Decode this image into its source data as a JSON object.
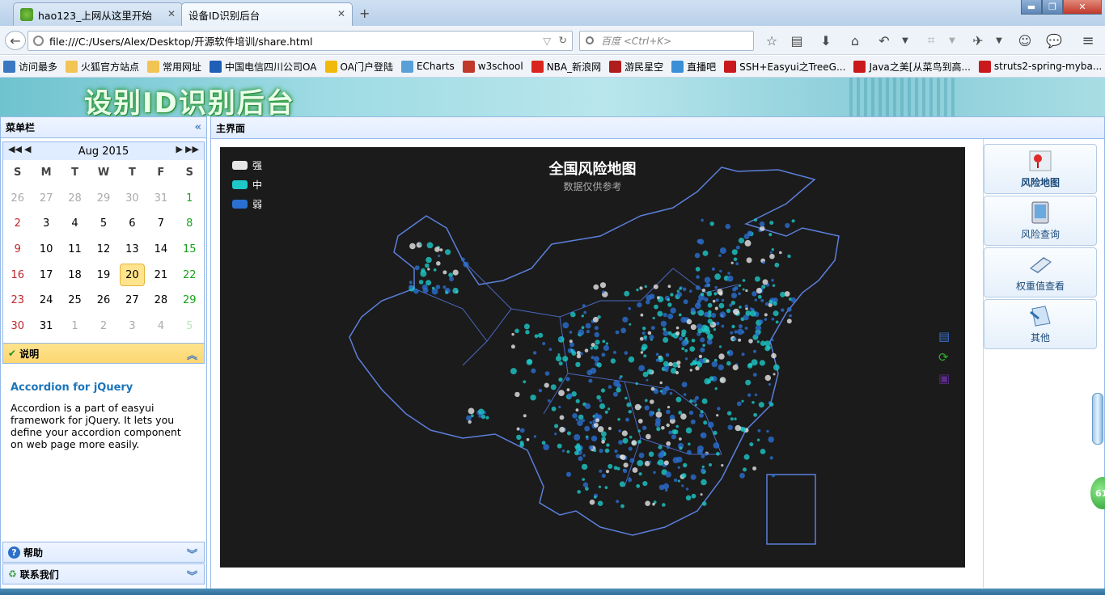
{
  "browser": {
    "tabs": [
      {
        "title": "hao123_上网从这里开始",
        "active": false
      },
      {
        "title": "设备ID识别后台",
        "active": true
      }
    ],
    "url": "file:///C:/Users/Alex/Desktop/开源软件培训/share.html",
    "search_placeholder": "百度 <Ctrl+K>",
    "bookmarks": [
      {
        "label": "访问最多",
        "icon": "gear-bookmark-icon",
        "color": "#3b78c2"
      },
      {
        "label": "火狐官方站点",
        "icon": "folder-icon",
        "color": "#f1c453"
      },
      {
        "label": "常用网址",
        "icon": "folder-icon",
        "color": "#f1c453"
      },
      {
        "label": "中国电信四川公司OA",
        "icon": "telecom-icon",
        "color": "#1f5fb6"
      },
      {
        "label": "OA门户登陆",
        "icon": "star-icon",
        "color": "#f0b90b"
      },
      {
        "label": "ECharts",
        "icon": "echarts-icon",
        "color": "#5aa0d8"
      },
      {
        "label": "w3school",
        "icon": "w3school-icon",
        "color": "#c0392b"
      },
      {
        "label": "NBA_新浪网",
        "icon": "sina-icon",
        "color": "#d9251d"
      },
      {
        "label": "游民星空",
        "icon": "gamersky-icon",
        "color": "#b01d1d"
      },
      {
        "label": "直播吧",
        "icon": "zhibo8-icon",
        "color": "#3b8fd6"
      },
      {
        "label": "SSH+Easyui之TreeG...",
        "icon": "csdn-icon",
        "color": "#c9191d"
      },
      {
        "label": "Java之美[从菜鸟到高...",
        "icon": "csdn-icon",
        "color": "#c9191d"
      },
      {
        "label": "struts2-spring-myba...",
        "icon": "csdn-icon",
        "color": "#c9191d"
      }
    ]
  },
  "banner": {
    "title": "设别ID识别后台"
  },
  "west": {
    "title": "菜单栏",
    "calendar": {
      "month_label": "Aug 2015",
      "weekdays": [
        "S",
        "M",
        "T",
        "W",
        "T",
        "F",
        "S"
      ],
      "weeks": [
        [
          "26",
          "27",
          "28",
          "29",
          "30",
          "31",
          "1"
        ],
        [
          "2",
          "3",
          "4",
          "5",
          "6",
          "7",
          "8"
        ],
        [
          "9",
          "10",
          "11",
          "12",
          "13",
          "14",
          "15"
        ],
        [
          "16",
          "17",
          "18",
          "19",
          "20",
          "21",
          "22"
        ],
        [
          "23",
          "24",
          "25",
          "26",
          "27",
          "28",
          "29"
        ],
        [
          "30",
          "31",
          "1",
          "2",
          "3",
          "4",
          "5"
        ]
      ],
      "today": "20"
    },
    "accordion": {
      "explain": {
        "title": "说明",
        "heading": "Accordion for jQuery",
        "text": "Accordion is a part of easyui framework for jQuery. It lets you define your accordion component on web page more easily."
      },
      "help": {
        "title": "帮助"
      },
      "contact": {
        "title": "联系我们"
      }
    }
  },
  "center": {
    "title": "主界面",
    "chart_data": {
      "type": "scatter",
      "title": "全国风险地图",
      "subtitle": "数据仅供参考",
      "legend": [
        {
          "name": "强",
          "color": "#e6e6e6"
        },
        {
          "name": "中",
          "color": "#1ec8c8"
        },
        {
          "name": "弱",
          "color": "#2a6fd1"
        }
      ],
      "background": "#1b1b1b",
      "map": "China",
      "legend_position": "top-left"
    },
    "right_menu": [
      {
        "label": "风险地图",
        "icon": "map-pin-icon",
        "active": true
      },
      {
        "label": "风险查询",
        "icon": "tablet-icon",
        "active": false
      },
      {
        "label": "权重值查看",
        "icon": "scanner-icon",
        "active": false
      },
      {
        "label": "其他",
        "icon": "paper-icon",
        "active": false
      }
    ]
  },
  "misc": {
    "side_badge": "61"
  }
}
